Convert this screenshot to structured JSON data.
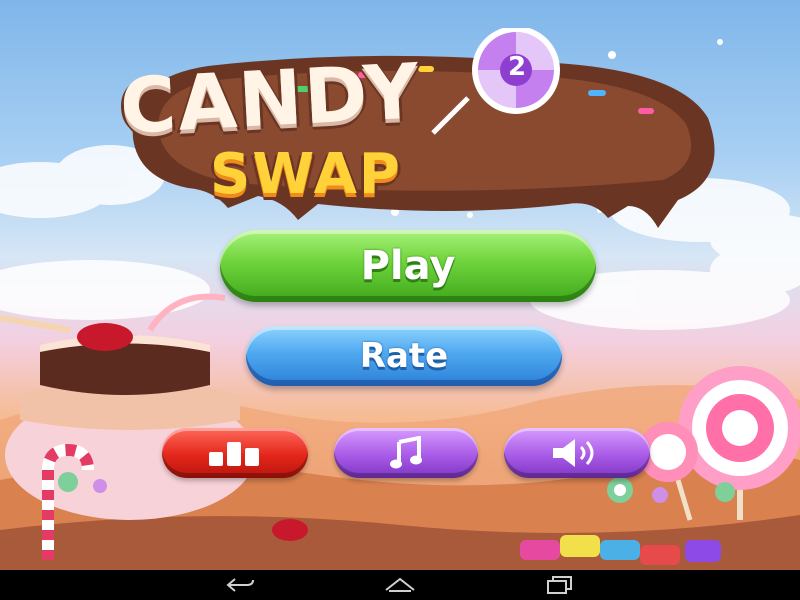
{
  "game": {
    "title_line1": "CANDY",
    "title_line2": "SWAP",
    "lollipop_number": "2"
  },
  "menu": {
    "play_label": "Play",
    "rate_label": "Rate"
  },
  "icons": {
    "leaderboard": "leaderboard-icon",
    "music": "music-note-icon",
    "sound": "speaker-icon",
    "back": "back-icon",
    "home": "home-icon",
    "recents": "recent-apps-icon"
  },
  "colors": {
    "play_green": "#5cc62c",
    "rate_blue": "#3f97e8",
    "leaderboard_red": "#e3261b",
    "music_purple": "#a85be6",
    "sound_purple": "#a85be6",
    "title_cream": "#fff4e6",
    "subtitle_yellow": "#ffd23a",
    "chocolate": "#6a3623"
  }
}
